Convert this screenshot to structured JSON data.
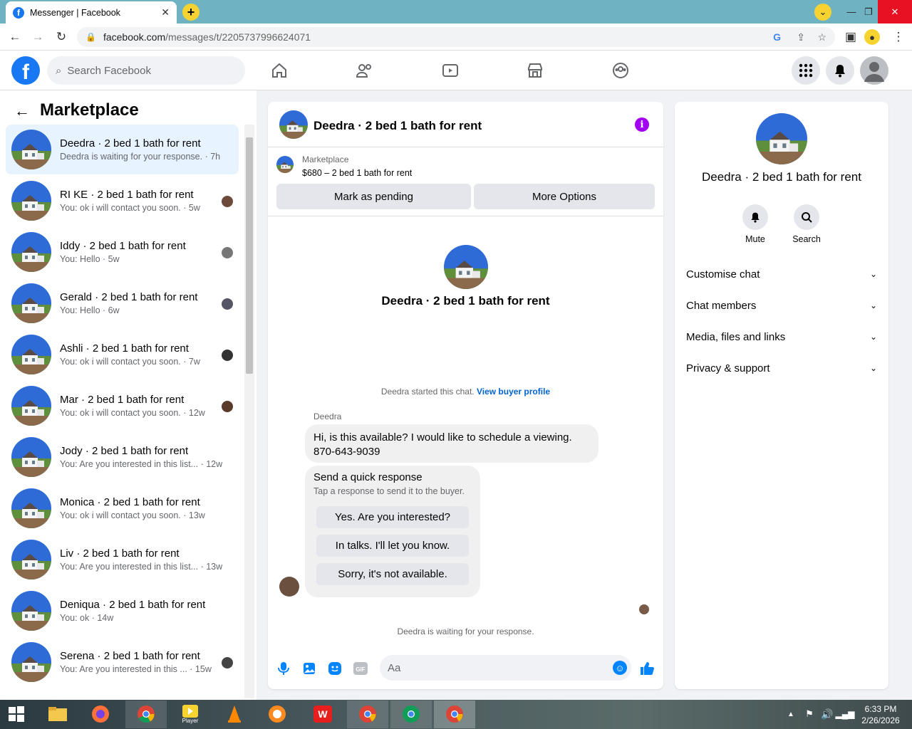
{
  "browser": {
    "tab_title": "Messenger | Facebook",
    "tab_close": "✕",
    "new_tab": "+",
    "url_domain": "facebook.com",
    "url_path": "/messages/t/2205737996624071",
    "window_controls": [
      "⌄",
      "—",
      "❐",
      "✕"
    ]
  },
  "header": {
    "search_placeholder": "Search Facebook",
    "logo_letter": "f"
  },
  "left": {
    "title": "Marketplace",
    "conversations": [
      {
        "name": "Deedra · 2 bed 1 bath for rent",
        "sub": "Deedra is waiting for your response. · 7h"
      },
      {
        "name": "RI KE · 2 bed 1 bath for rent",
        "sub": "You: ok i will contact you soon. · 5w"
      },
      {
        "name": "Iddy · 2 bed 1 bath for rent",
        "sub": "You: Hello · 5w"
      },
      {
        "name": "Gerald · 2 bed 1 bath for rent",
        "sub": "You: Hello · 6w"
      },
      {
        "name": "Ashli · 2 bed 1 bath for rent",
        "sub": "You: ok i will contact you soon. · 7w"
      },
      {
        "name": "Mar · 2 bed 1 bath for rent",
        "sub": "You: ok i will contact you soon. · 12w"
      },
      {
        "name": "Jody · 2 bed 1 bath for rent",
        "sub": "You: Are you interested in this list... · 12w"
      },
      {
        "name": "Monica · 2 bed 1 bath for rent",
        "sub": "You: ok i will contact you soon. · 13w"
      },
      {
        "name": "Liv · 2 bed 1 bath for rent",
        "sub": "You: Are you interested in this list... · 13w"
      },
      {
        "name": "Deniqua · 2 bed 1 bath for rent",
        "sub": "You: ok · 14w"
      },
      {
        "name": "Serena · 2 bed 1 bath for rent",
        "sub": "You: Are you interested in this ... · 15w"
      }
    ]
  },
  "chat": {
    "title": "Deedra · 2 bed 1 bath for rent",
    "listing_label": "Marketplace",
    "listing_detail": "$680 – 2 bed 1 bath for rent",
    "mark_pending": "Mark as pending",
    "more_options": "More Options",
    "intro_name": "Deedra · 2 bed 1 bath for rent",
    "started_text": "Deedra started this chat.",
    "view_buyer": "View buyer profile",
    "sender": "Deedra",
    "message": "Hi, is this available? I would like to schedule a viewing. 870-643-9039",
    "quick_title": "Send a quick response",
    "quick_sub": "Tap a response to send it to the buyer.",
    "quick_replies": [
      "Yes. Are you interested?",
      "In talks. I'll let you know.",
      "Sorry, it's not available."
    ],
    "waiting": "Deedra is waiting for your response.",
    "input_placeholder": "Aa"
  },
  "right": {
    "name": "Deedra · 2 bed 1 bath for rent",
    "mute": "Mute",
    "search": "Search",
    "sections": [
      "Customise chat",
      "Chat members",
      "Media, files and links",
      "Privacy & support"
    ]
  },
  "taskbar": {
    "time": "6:33 PM",
    "date": "2/26/2026",
    "player_label": "Player"
  },
  "colors": {
    "brand": "#1877f2",
    "info": "#a100f2",
    "active_row": "#e7f3ff"
  }
}
